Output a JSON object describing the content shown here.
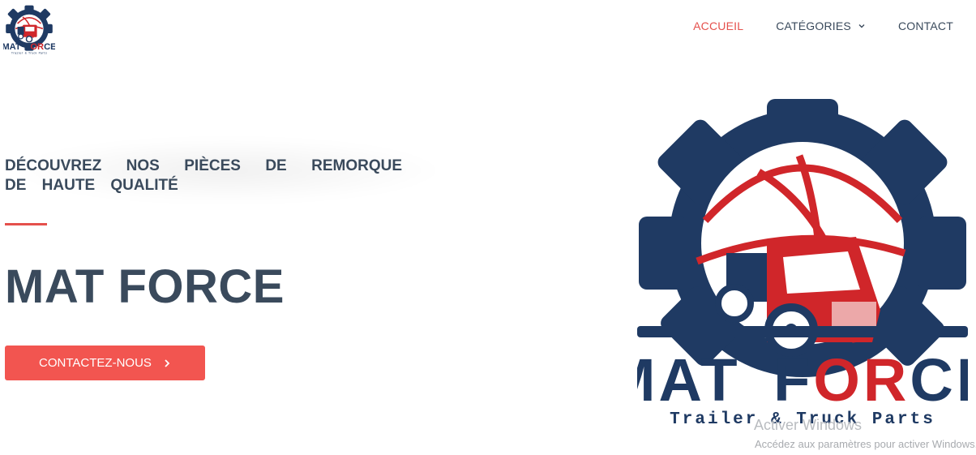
{
  "brand": {
    "name_mat": "MAT",
    "name_force_f": "F",
    "name_force_or": "OR",
    "name_force_ce": "CE",
    "tagline": "Trailer & Truck Parts",
    "colors": {
      "navy": "#1f3a63",
      "red": "#d0262a",
      "accent": "#e5504c",
      "text": "#3a4a5c"
    }
  },
  "nav": {
    "items": [
      {
        "label": "ACCUEIL",
        "active": true
      },
      {
        "label": "CATÉGORIES",
        "icon": "chevron-down-icon"
      },
      {
        "label": "CONTACT"
      }
    ]
  },
  "hero": {
    "eyebrow": "DÉCOUVREZ NOS PIÈCES DE REMORQUE DE HAUTE QUALITÉ",
    "title": "MAT FORCE",
    "cta_label": "CONTACTEZ-NOUS",
    "cta_icon": "chevron-right-icon"
  },
  "watermark": {
    "title": "Activer Windows",
    "subtitle": "Accédez aux paramètres pour activer Windows."
  }
}
